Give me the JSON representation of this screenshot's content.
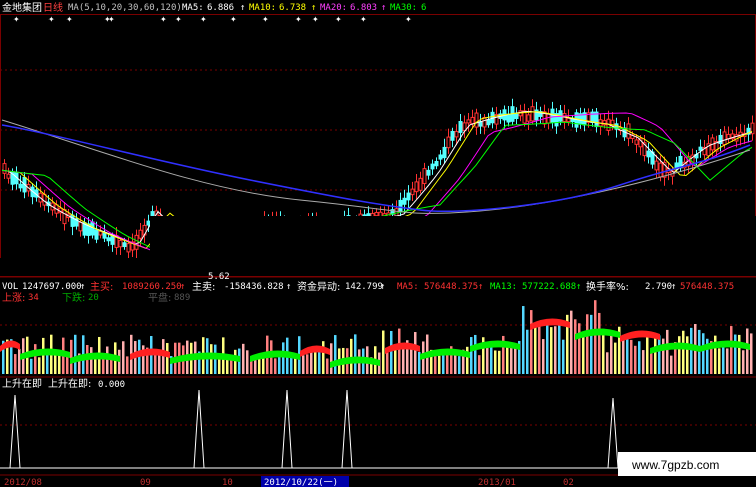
{
  "header": {
    "stock_name": "金地集团",
    "period": "日线",
    "ma_params": "MA(5,10,20,30,60,120)",
    "ma5_label": "MA5:",
    "ma5_value": "6.886",
    "ma10_label": "MA10:",
    "ma10_value": "6.738",
    "ma20_label": "MA20:",
    "ma20_value": "6.803",
    "ma30_label": "MA30:",
    "ma30_value": "6",
    "arrow": "↑"
  },
  "price_panel": {
    "low_label": "5.62"
  },
  "volume_panel": {
    "vol_label": "VOL",
    "vol_value": "1247697.000",
    "main_buy_label": "主买:",
    "main_buy_value": "1089260.250",
    "main_sell_label": "主卖:",
    "main_sell_value": "-158436.828",
    "flow_label": "资金异动:",
    "flow_value": "142.799",
    "ma5_label": "MA5:",
    "ma5_value": "576448.375",
    "ma13_label": "MA13:",
    "ma13_value": "577222.688",
    "turnover_label": "换手率%:",
    "turnover_value": "2.790",
    "tail_value": "576448.375",
    "up_label": "上涨:",
    "up_value": "34",
    "down_label": "下跌:",
    "down_value": "20",
    "flat_label": "平盘:",
    "flat_value": "889"
  },
  "indicator_panel": {
    "name": "上升在即",
    "line_label": "上升在即:",
    "line_value": "0.000"
  },
  "x_axis": {
    "labels": [
      "2012/08",
      "09",
      "10",
      "2012/10/22(一)",
      "2013/01",
      "02"
    ]
  },
  "watermark": "www.7gpzb.com",
  "colors": {
    "up": "#ff3232",
    "down": "#54ffff",
    "ma5": "#ffffff",
    "ma10": "#ffff00",
    "ma20": "#ff00ff",
    "ma30": "#00ff00",
    "ma60": "#aaaaaa",
    "ma120": "#3030ff",
    "grid": "#7a0000",
    "label_blue": "#0000aa"
  },
  "chart_data": {
    "type": "candlestick",
    "price_ma_lines": [
      "MA5",
      "MA10",
      "MA20",
      "MA30",
      "MA60",
      "MA120"
    ],
    "annotated_low": 5.62,
    "indicator_spikes_x": [
      "2012/08",
      "2012/10",
      "2012/10",
      "2012/11",
      "2013/02"
    ],
    "indicator_value": 0
  }
}
